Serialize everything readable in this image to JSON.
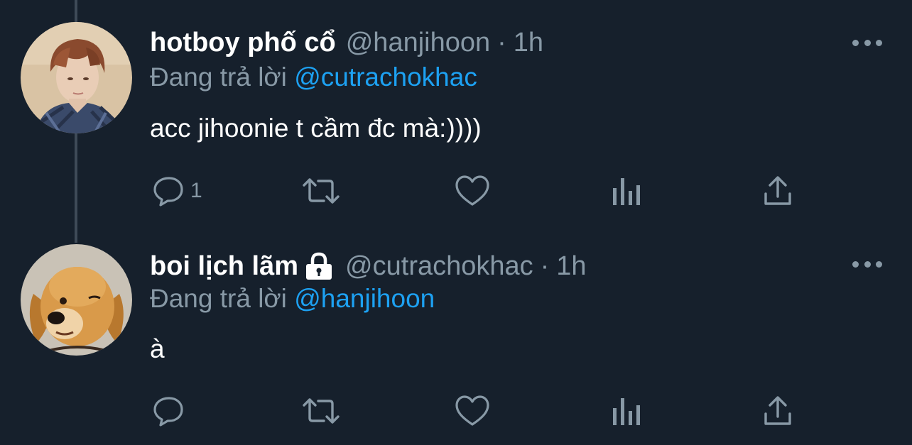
{
  "tweets": [
    {
      "name": "hotboy phố cổ",
      "handle": "@hanjihoon",
      "separator": "·",
      "time": "1h",
      "reply_prefix": "Đang trả lời",
      "reply_to": "@cutrachokhac",
      "text": "acc jihoonie t cầm đc mà:))))",
      "reply_count": "1",
      "locked": false,
      "avatar": "person-avatar"
    },
    {
      "name": "boi lịch lãm",
      "handle": "@cutrachokhac",
      "separator": "·",
      "time": "1h",
      "reply_prefix": "Đang trả lời",
      "reply_to": "@hanjihoon",
      "text": "à",
      "reply_count": "",
      "locked": true,
      "avatar": "dog-avatar"
    }
  ],
  "icons": {
    "reply": "reply-icon",
    "retweet": "retweet-icon",
    "like": "heart-icon",
    "analytics": "analytics-icon",
    "share": "share-icon",
    "more": "more-icon",
    "lock": "lock-icon"
  },
  "colors": {
    "background": "#16202c",
    "secondary_text": "#8899a6",
    "link": "#1da1f2",
    "thread_line": "#3e4a57"
  }
}
